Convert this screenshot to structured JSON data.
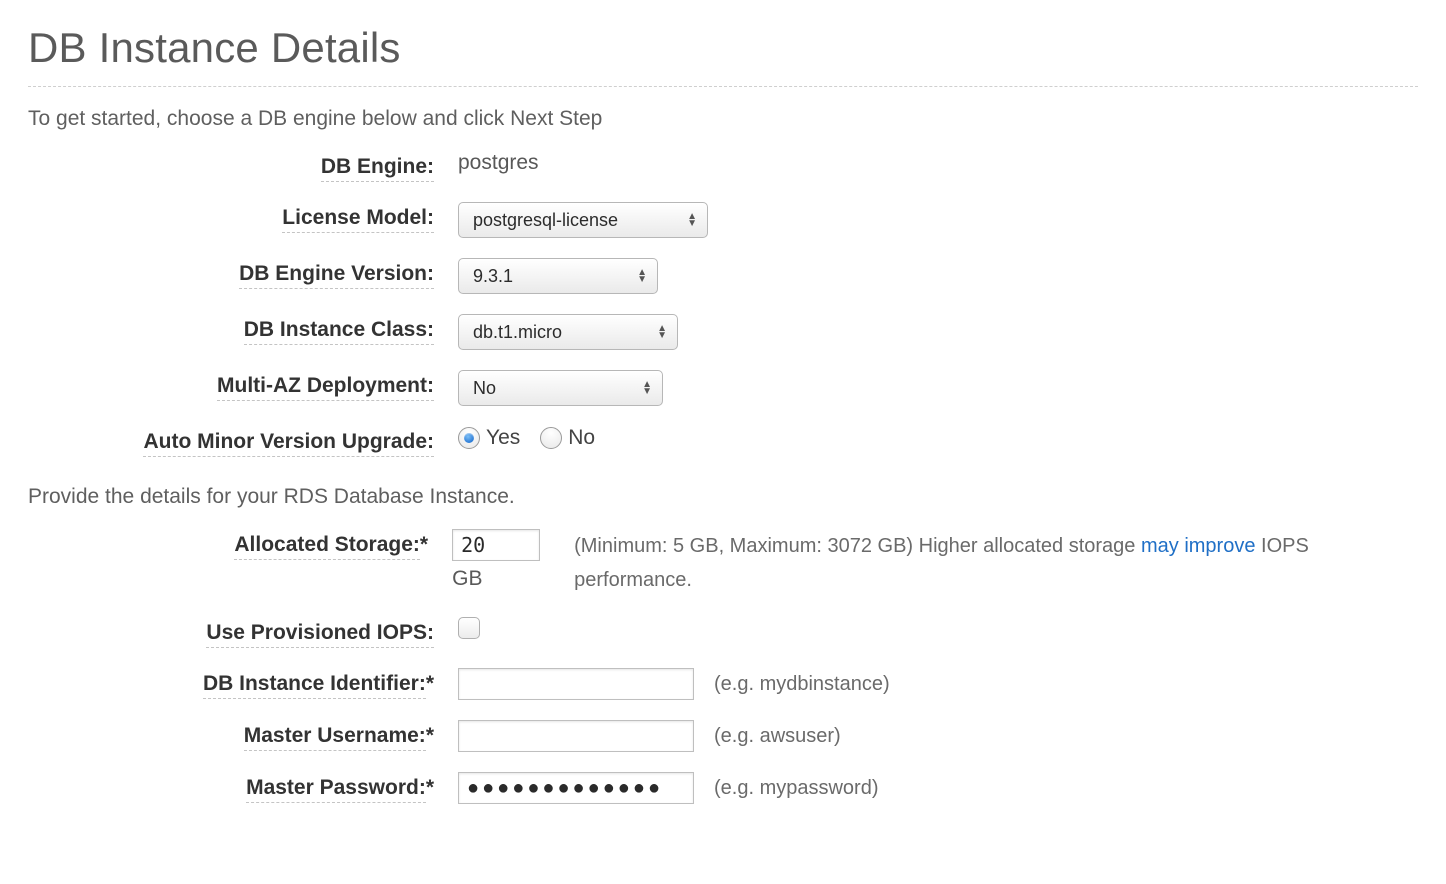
{
  "title": "DB Instance Details",
  "instruction1": "To get started, choose a DB engine below and click Next Step",
  "instruction2": "Provide the details for your RDS Database Instance.",
  "fields": {
    "db_engine": {
      "label": "DB Engine:",
      "value": "postgres"
    },
    "license_model": {
      "label": "License Model:",
      "selected": "postgresql-license"
    },
    "engine_version": {
      "label": "DB Engine Version:",
      "selected": "9.3.1"
    },
    "instance_class": {
      "label": "DB Instance Class:",
      "selected": "db.t1.micro"
    },
    "multi_az": {
      "label": "Multi-AZ Deployment:",
      "selected": "No"
    },
    "auto_minor_upgrade": {
      "label": "Auto Minor Version Upgrade:",
      "options": {
        "yes": "Yes",
        "no": "No"
      },
      "selected": "yes"
    },
    "allocated_storage": {
      "label": "Allocated Storage:",
      "required_suffix": "*",
      "value": "20",
      "unit": "GB",
      "hint_pre": "(Minimum: 5 GB, Maximum: 3072 GB) Higher allocated storage ",
      "hint_link": "may improve",
      "hint_post": " IOPS performance."
    },
    "use_iops": {
      "label": "Use Provisioned IOPS:",
      "checked": false
    },
    "instance_id": {
      "label": "DB Instance Identifier:",
      "required_suffix": "*",
      "value": "",
      "hint": "(e.g. mydbinstance)"
    },
    "master_username": {
      "label": "Master Username:",
      "required_suffix": "*",
      "value": "",
      "hint": "(e.g. awsuser)"
    },
    "master_password": {
      "label": "Master Password:",
      "required_suffix": "*",
      "value": "●●●●●●●●●●●●●",
      "hint": "(e.g. mypassword)"
    }
  }
}
